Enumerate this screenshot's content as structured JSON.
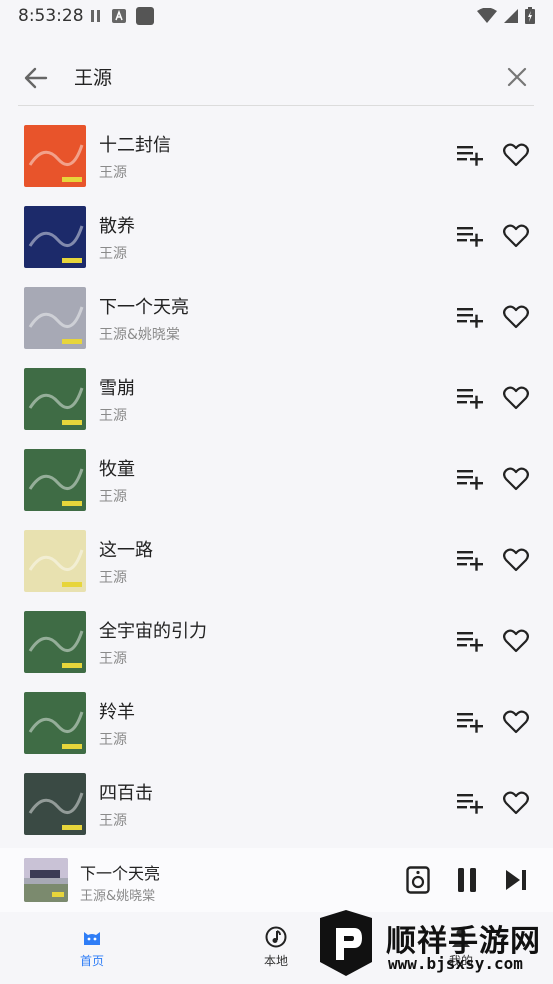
{
  "status_bar": {
    "time": "8:53:28"
  },
  "search": {
    "query": "王源"
  },
  "songs": [
    {
      "title": "十二封信",
      "artist": "王源",
      "cover_color": "#e8542b"
    },
    {
      "title": "散养",
      "artist": "王源",
      "cover_color": "#1c2a6a"
    },
    {
      "title": "下一个天亮",
      "artist": "王源&姚晓棠",
      "cover_color": "#a7a9b5"
    },
    {
      "title": "雪崩",
      "artist": "王源",
      "cover_color": "#3f6c45"
    },
    {
      "title": "牧童",
      "artist": "王源",
      "cover_color": "#3f6c45"
    },
    {
      "title": "这一路",
      "artist": "王源",
      "cover_color": "#e8e1b0"
    },
    {
      "title": "全宇宙的引力",
      "artist": "王源",
      "cover_color": "#3f6c45"
    },
    {
      "title": "羚羊",
      "artist": "王源",
      "cover_color": "#3f6c45"
    },
    {
      "title": "四百击",
      "artist": "王源",
      "cover_color": "#3a4a44"
    }
  ],
  "now_playing": {
    "title": "下一个天亮",
    "artist": "王源&姚晓棠"
  },
  "nav": {
    "home": "首页",
    "local": "本地",
    "me": "我的"
  },
  "watermark": {
    "text": "顺祥手游网",
    "url": "www.bjsxsy.com"
  },
  "colors": {
    "accent": "#2f7df6",
    "background": "#f6f6f9"
  }
}
